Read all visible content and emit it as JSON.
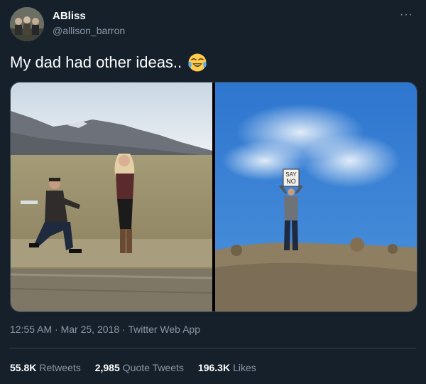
{
  "author": {
    "display_name": "ABliss",
    "handle": "@allison_barron",
    "avatar_icon": "avatar-photo"
  },
  "more_icon": "···",
  "tweet": {
    "text": "My dad had other ideas..",
    "emoji_icon": "face-with-tears-of-joy-icon"
  },
  "media": {
    "left_photo": "proposal-photo",
    "right_photo": "dad-sign-photo",
    "sign_text_line1": "SAY",
    "sign_text_line2": "NO"
  },
  "meta": {
    "time": "12:55 AM",
    "date": "Mar 25, 2018",
    "source": "Twitter Web App",
    "separator": "·"
  },
  "stats": {
    "retweets_count": "55.8K",
    "retweets_label": "Retweets",
    "quotes_count": "2,985",
    "quotes_label": "Quote Tweets",
    "likes_count": "196.3K",
    "likes_label": "Likes"
  },
  "colors": {
    "background": "#15202b",
    "text": "#ffffff",
    "secondary": "#8b98a5",
    "border": "#38444d"
  }
}
